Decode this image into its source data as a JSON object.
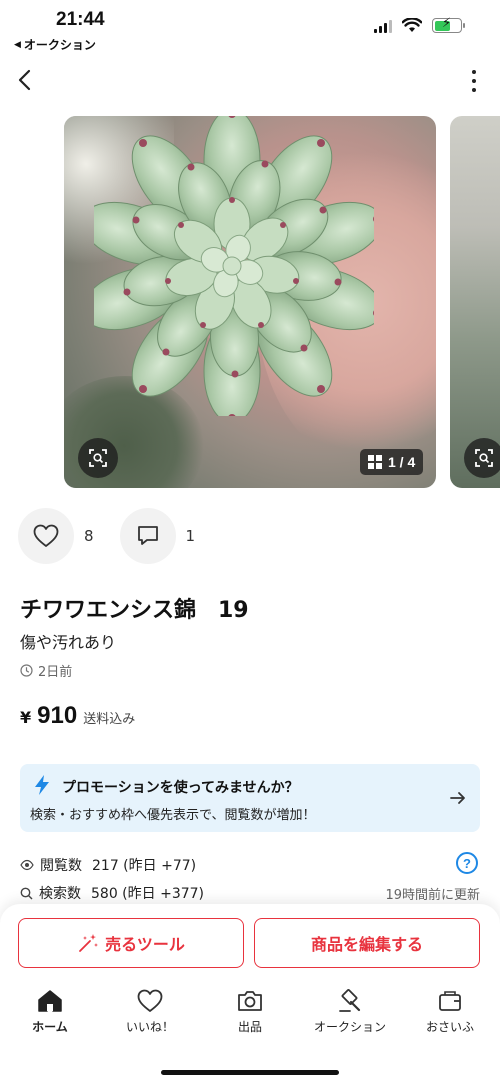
{
  "status_bar": {
    "time": "21:44",
    "back_app": "オークション",
    "icons": [
      "signal-icon",
      "wifi-icon",
      "battery-charging-icon"
    ]
  },
  "nav": {
    "back_icon": "chevron-left-icon",
    "more_icon": "more-vertical-icon"
  },
  "gallery": {
    "counter": "1 / 4",
    "current_index": 1,
    "total_images": 4,
    "lens_icon": "image-search-icon"
  },
  "actions": {
    "likes_count": "8",
    "comments_count": "1"
  },
  "item": {
    "title": "チワワエンシス錦　19",
    "condition": "傷や汚れあり",
    "posted": "2日前",
    "price_currency": "¥",
    "price_amount": "910",
    "shipping": "送料込み"
  },
  "promotion": {
    "title": "プロモーションを使ってみませんか？",
    "description": "検索・おすすめ枠へ優先表示で、閲覧数が増加！"
  },
  "stats": {
    "views_label": "閲覧数",
    "views_value": "217 (昨日 +77)",
    "search_label": "検索数",
    "search_value": "580 (昨日 +377)",
    "help": "?",
    "updated": "19時間前に更新"
  },
  "buttons": {
    "sell_tool": "売るツール",
    "edit_item": "商品を編集する"
  },
  "tabbar": {
    "items": [
      {
        "label": "ホーム",
        "icon": "home-icon",
        "active": true
      },
      {
        "label": "いいね！",
        "icon": "heart-icon",
        "active": false
      },
      {
        "label": "出品",
        "icon": "camera-icon",
        "active": false
      },
      {
        "label": "オークション",
        "icon": "gavel-icon",
        "active": false
      },
      {
        "label": "おさいふ",
        "icon": "wallet-icon",
        "active": false
      }
    ]
  },
  "colors": {
    "accent_red": "#e8333e",
    "promo_bg": "#e6f3fc",
    "link_blue": "#1e88e5",
    "battery_green": "#34c759"
  }
}
